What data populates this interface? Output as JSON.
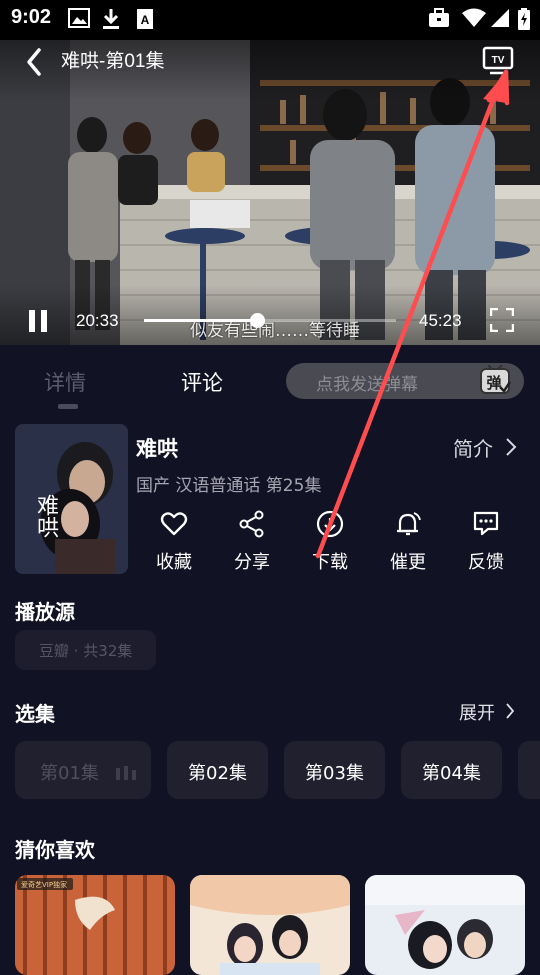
{
  "status_bar": {
    "time": "9:02"
  },
  "player": {
    "title": "难哄-第01集",
    "current_time": "20:33",
    "total_time": "45:23",
    "progress_fraction": 0.45,
    "subtitle": "似友有些闹……等待睡"
  },
  "tabs": {
    "detail": "详情",
    "comment": "评论"
  },
  "danmu": {
    "placeholder": "点我发送弹幕",
    "icon_char": "弹"
  },
  "show": {
    "title": "难哄",
    "meta": "国产 汉语普通话 第25集",
    "intro_label": "简介",
    "poster_text": "难哄"
  },
  "actions": [
    {
      "icon": "heart-icon",
      "label": "收藏"
    },
    {
      "icon": "share-icon",
      "label": "分享"
    },
    {
      "icon": "download-icon",
      "label": "下载"
    },
    {
      "icon": "bell-icon",
      "label": "催更"
    },
    {
      "icon": "feedback-icon",
      "label": "反馈"
    }
  ],
  "sources": {
    "title": "播放源",
    "selected": "豆瓣 · 共32集"
  },
  "episodes": {
    "title": "选集",
    "expand_label": "展开",
    "items": [
      "第01集",
      "第02集",
      "第03集",
      "第04集"
    ]
  },
  "recommend": {
    "title": "猜你喜欢",
    "card1_badge": "爱奇艺VIP独家"
  },
  "colors": {
    "background": "#121225",
    "accent": "#ff4d4f"
  }
}
